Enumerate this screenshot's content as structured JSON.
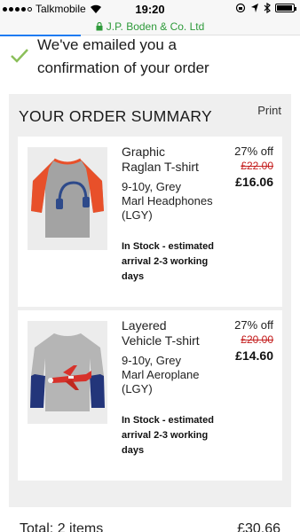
{
  "status_bar": {
    "carrier": "Talkmobile",
    "time": "19:20"
  },
  "browser": {
    "url": "J.P. Boden & Co. Ltd",
    "load_progress": 0.27,
    "secure": true
  },
  "confirmation": {
    "line1": "We've emailed you a",
    "line2": "confirmation of your order",
    "icon": "check-icon",
    "icon_color": "#8bbf5a"
  },
  "summary": {
    "title": "YOUR ORDER SUMMARY",
    "print_label": "Print",
    "items": [
      {
        "name_line1": "Graphic",
        "name_line2": "Raglan T-shirt",
        "variant_line1": "9-10y, Grey",
        "variant_line2": "Marl Headphones",
        "variant_line3": "(LGY)",
        "stock_line1": "In Stock - estimated",
        "stock_line2": "arrival 2-3 working",
        "stock_line3": "days",
        "discount": "27% off",
        "was_price": "£22.00",
        "now_price": "£16.06"
      },
      {
        "name_line1": "Layered",
        "name_line2": "Vehicle T-shirt",
        "variant_line1": "9-10y, Grey",
        "variant_line2": "Marl Aeroplane",
        "variant_line3": "(LGY)",
        "stock_line1": "In Stock - estimated",
        "stock_line2": "arrival 2-3 working",
        "stock_line3": "days",
        "discount": "27% off",
        "was_price": "£20.00",
        "now_price": "£14.60"
      }
    ],
    "total_label": "Total: 2 items",
    "total_value": "£30.66"
  },
  "colors": {
    "accent_green": "#2e9a3a",
    "sale_red": "#c41e1e",
    "progress_blue": "#1f7cf2"
  }
}
